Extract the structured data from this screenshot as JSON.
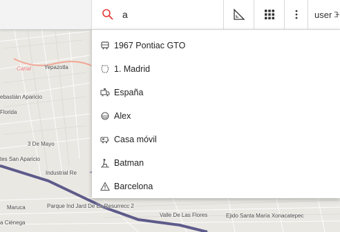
{
  "search": {
    "value": "a"
  },
  "toolbar": {
    "user_label": "user"
  },
  "results": [
    {
      "label": "1967 Pontiac GTO",
      "icon": "bus-icon"
    },
    {
      "label": "1. Madrid",
      "icon": "region-icon"
    },
    {
      "label": "España",
      "icon": "truck-icon"
    },
    {
      "label": "Alex",
      "icon": "helmet-icon"
    },
    {
      "label": "Casa móvil",
      "icon": "camper-icon"
    },
    {
      "label": "Batman",
      "icon": "worker-icon"
    },
    {
      "label": "Barcelona",
      "icon": "warning-icon"
    }
  ],
  "map_labels": {
    "canal": "Canal",
    "yepazotla": "Yepazotla",
    "sebastian": "ebastián Aparicio",
    "florida": "Florida",
    "tres_de_mayo": "3 De Mayo",
    "tes_san_aparicio": "tes San Aparicio",
    "industrial": "Industrial Re",
    "maruca": "Maruca",
    "parque": "Parque Ind Jard De La Resurrecc 2",
    "valle": "Valle De Las Flores",
    "ejido": "Ejido Santa María Xonacatepec",
    "cienega": "a Ciénega"
  },
  "colors": {
    "search_icon": "#e53935",
    "road": "#5d5b8a",
    "accent": "#333333"
  }
}
